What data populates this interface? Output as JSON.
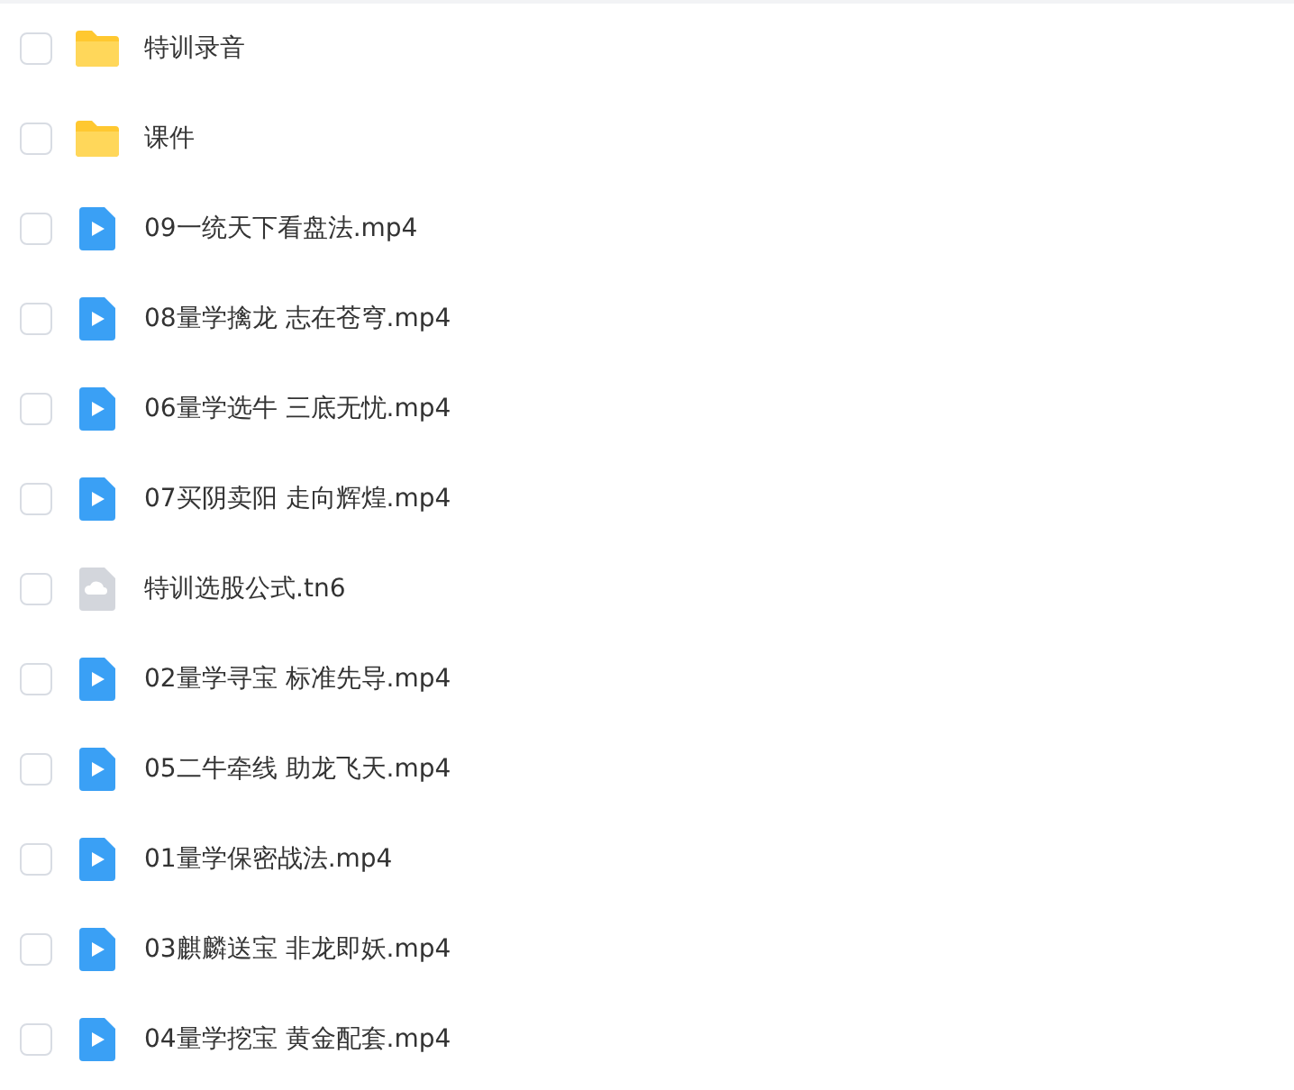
{
  "files": [
    {
      "name": "特训录音",
      "kind": "folder",
      "checked": false
    },
    {
      "name": "课件",
      "kind": "folder",
      "checked": false
    },
    {
      "name": "09一统天下看盘法.mp4",
      "kind": "video",
      "checked": false
    },
    {
      "name": "08量学擒龙 志在苍穹.mp4",
      "kind": "video",
      "checked": false
    },
    {
      "name": "06量学选牛 三底无忧.mp4",
      "kind": "video",
      "checked": false
    },
    {
      "name": "07买阴卖阳 走向辉煌.mp4",
      "kind": "video",
      "checked": false
    },
    {
      "name": "特训选股公式.tn6",
      "kind": "other",
      "checked": false
    },
    {
      "name": "02量学寻宝 标准先导.mp4",
      "kind": "video",
      "checked": false
    },
    {
      "name": "05二牛牵线 助龙飞天.mp4",
      "kind": "video",
      "checked": false
    },
    {
      "name": "01量学保密战法.mp4",
      "kind": "video",
      "checked": false
    },
    {
      "name": "03麒麟送宝 非龙即妖.mp4",
      "kind": "video",
      "checked": false
    },
    {
      "name": "04量学挖宝 黄金配套.mp4",
      "kind": "video",
      "checked": false
    }
  ]
}
